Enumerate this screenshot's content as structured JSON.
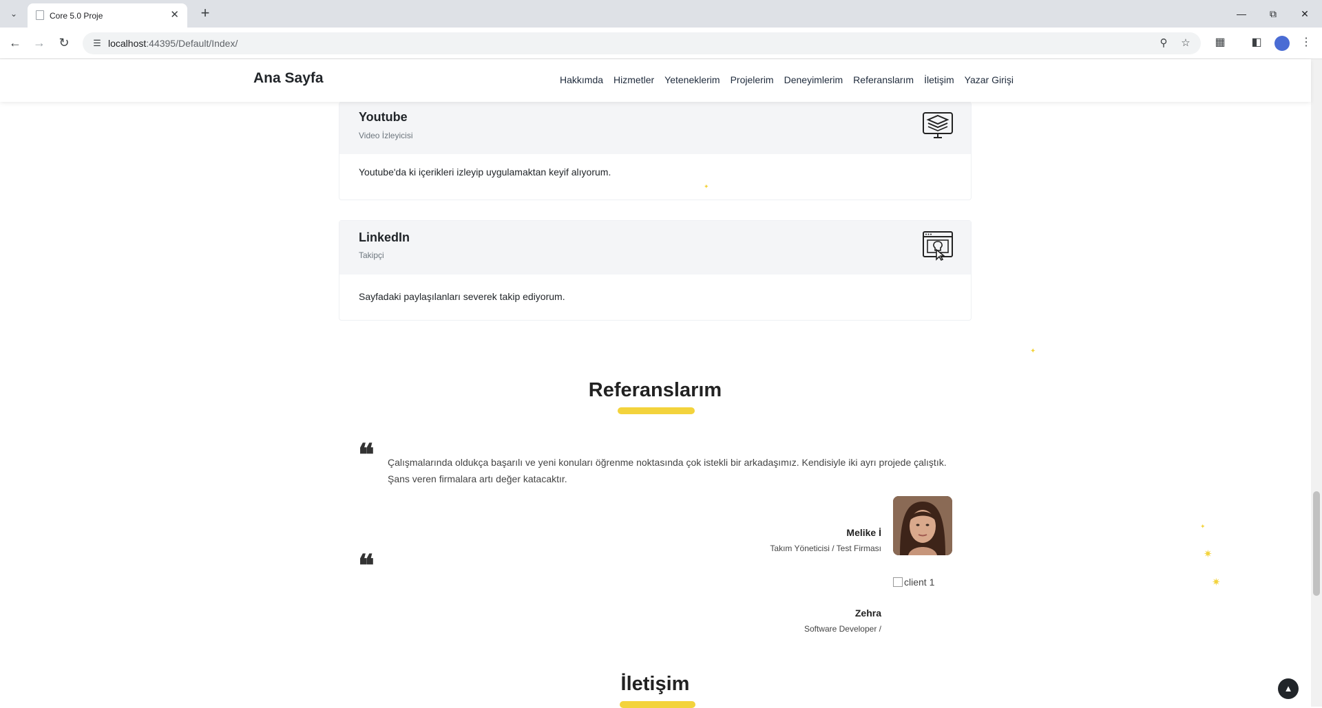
{
  "browser": {
    "tab_title": "Core 5.0 Proje",
    "url_host": "localhost",
    "url_rest": ":44395/Default/Index/",
    "icons": {
      "tab_list": "chevron-down-icon",
      "close_tab": "close-icon",
      "new_tab": "plus-icon",
      "back": "back-arrow-icon",
      "forward": "forward-arrow-icon",
      "reload": "reload-icon",
      "site_info": "tune-icon",
      "zoom": "zoom-icon",
      "bookmark": "star-icon",
      "extensions": "puzzle-icon",
      "side_panel": "side-panel-icon",
      "menu": "kebab-menu-icon"
    }
  },
  "site": {
    "brand": "Ana Sayfa",
    "nav": [
      "Hakkımda",
      "Hizmetler",
      "Yeteneklerim",
      "Projelerim",
      "Deneyimlerim",
      "Referanslarım",
      "İletişim",
      "Yazar Girişi"
    ]
  },
  "experiences": [
    {
      "title": "Youtube",
      "subtitle": "Video İzleyicisi",
      "text": "Youtube'da ki içerikleri izleyip uygulamaktan keyif alıyorum.",
      "icon": "monitor-layers-icon"
    },
    {
      "title": "LinkedIn",
      "subtitle": "Takipçi",
      "text": "Sayfadaki paylaşılanları severek takip ediyorum.",
      "icon": "browser-pointer-icon"
    }
  ],
  "references": {
    "heading": "Referanslarım",
    "items": [
      {
        "text": "Çalışmalarında oldukça başarılı ve yeni konuları öğrenme noktasında çok istekli bir arkadaşımız. Kendisiyle iki ayrı projede çalıştık. Şans veren firmalara artı değer katacaktır.",
        "name": "Melike İ",
        "role": "Takım Yöneticisi / Test Firması"
      },
      {
        "text": "",
        "name": "Zehra",
        "role": "Software Developer /",
        "image_alt": "client 1"
      }
    ]
  },
  "contact": {
    "heading": "İletişim"
  },
  "colors": {
    "accent": "#f3d33c",
    "text": "#212529",
    "card_head": "#f4f5f7"
  }
}
